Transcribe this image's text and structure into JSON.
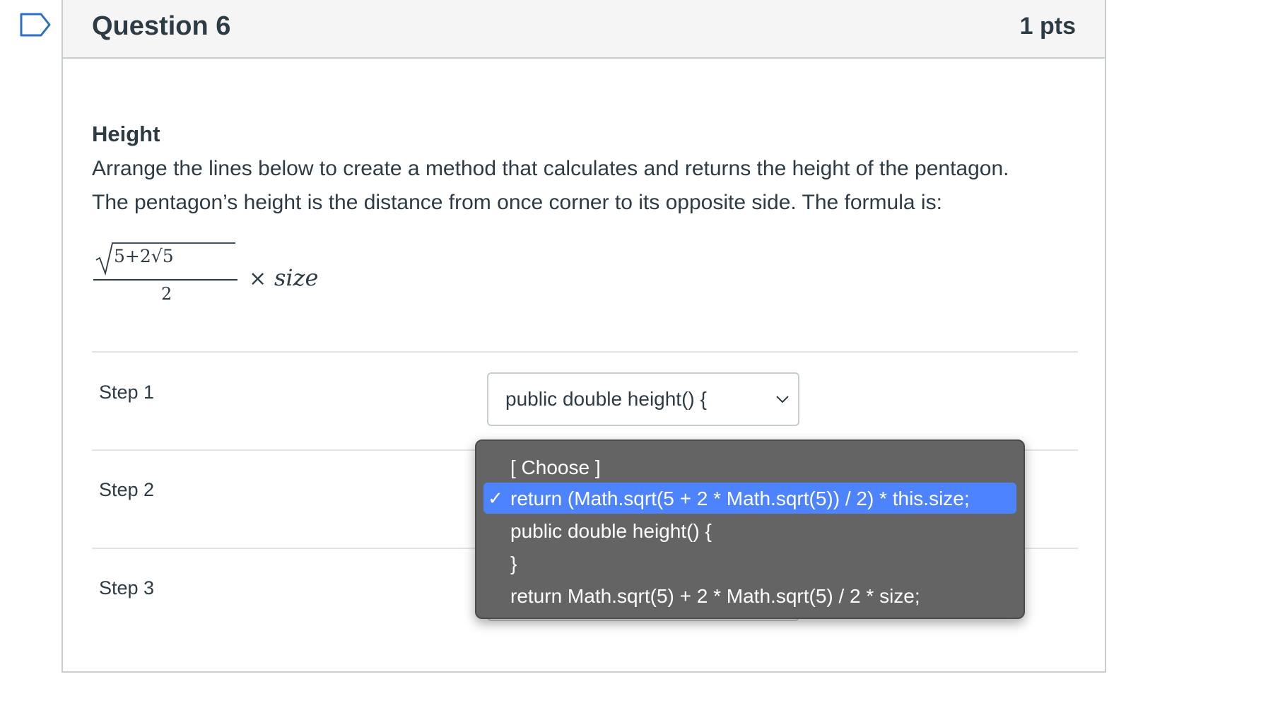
{
  "question": {
    "title": "Question 6",
    "points": "1 pts",
    "heading": "Height",
    "paragraph_line1": "Arrange the lines below to create a method that calculates and returns the height of the pentagon.",
    "paragraph_line2": "The pentagon’s height is the distance from once corner to its opposite side. The formula is:",
    "formula": {
      "numerator": "5+2√5",
      "denominator": "2",
      "operator": "×",
      "variable": "size"
    }
  },
  "steps": [
    {
      "label": "Step 1",
      "selected_value": "public double height() {"
    },
    {
      "label": "Step 2",
      "selected_value": ""
    },
    {
      "label": "Step 3",
      "selected_value": ""
    }
  ],
  "dropdown": {
    "check_glyph": "✓",
    "options": [
      {
        "label": "[ Choose ]",
        "selected": false
      },
      {
        "label": "return (Math.sqrt(5 + 2 * Math.sqrt(5)) / 2) * this.size;",
        "selected": true
      },
      {
        "label": "public double height() {",
        "selected": false
      },
      {
        "label": "}",
        "selected": false
      },
      {
        "label": "return Math.sqrt(5) + 2 * Math.sqrt(5) / 2 * size;",
        "selected": false
      }
    ]
  },
  "colors": {
    "text": "#2d3b45",
    "border": "#c7cdd1",
    "header_bg": "#f5f5f5",
    "flag_stroke": "#2d6fc4",
    "dropdown_bg": "#646464",
    "dropdown_selected": "#4d83ff"
  },
  "icons": {
    "flag": "flag-icon",
    "chevron": "chevron-down-icon",
    "check": "check-icon"
  }
}
